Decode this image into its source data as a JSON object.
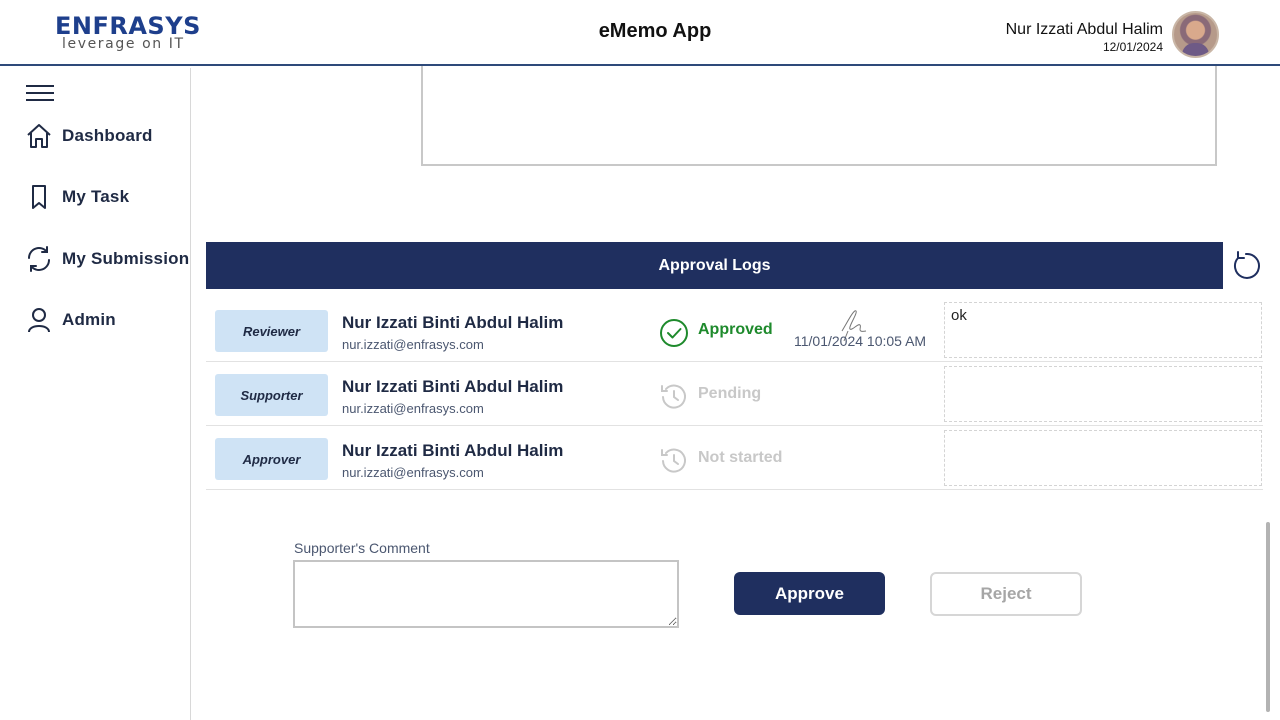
{
  "header": {
    "logo_main": "ENFRASYS",
    "logo_sub": "leverage on IT",
    "app_title": "eMemo App",
    "user_name": "Nur Izzati Abdul Halim",
    "user_date": "12/01/2024"
  },
  "sidebar": {
    "items": [
      {
        "label": "Dashboard",
        "icon": "home-icon"
      },
      {
        "label": "My Task",
        "icon": "bookmark-icon"
      },
      {
        "label": "My Submission",
        "icon": "sync-icon"
      },
      {
        "label": "Admin",
        "icon": "user-icon"
      }
    ]
  },
  "approval_logs": {
    "title": "Approval Logs",
    "rows": [
      {
        "role": "Reviewer",
        "name": "Nur Izzati Binti Abdul Halim",
        "email": "nur.izzati@enfrasys.com",
        "status": "Approved",
        "status_icon": "check-circle-icon",
        "timestamp": "11/01/2024 10:05 AM",
        "comment": "ok"
      },
      {
        "role": "Supporter",
        "name": "Nur Izzati Binti Abdul Halim",
        "email": "nur.izzati@enfrasys.com",
        "status": "Pending",
        "status_icon": "history-icon",
        "timestamp": "",
        "comment": ""
      },
      {
        "role": "Approver",
        "name": "Nur Izzati Binti Abdul Halim",
        "email": "nur.izzati@enfrasys.com",
        "status": "Not started",
        "status_icon": "history-icon",
        "timestamp": "",
        "comment": ""
      }
    ]
  },
  "comment_form": {
    "label": "Supporter's Comment",
    "value": "",
    "approve_label": "Approve",
    "reject_label": "Reject"
  },
  "colors": {
    "primary": "#1f2f5f",
    "approved": "#1e8a2c",
    "badge": "#cfe3f5",
    "muted": "#c8c8c8"
  }
}
